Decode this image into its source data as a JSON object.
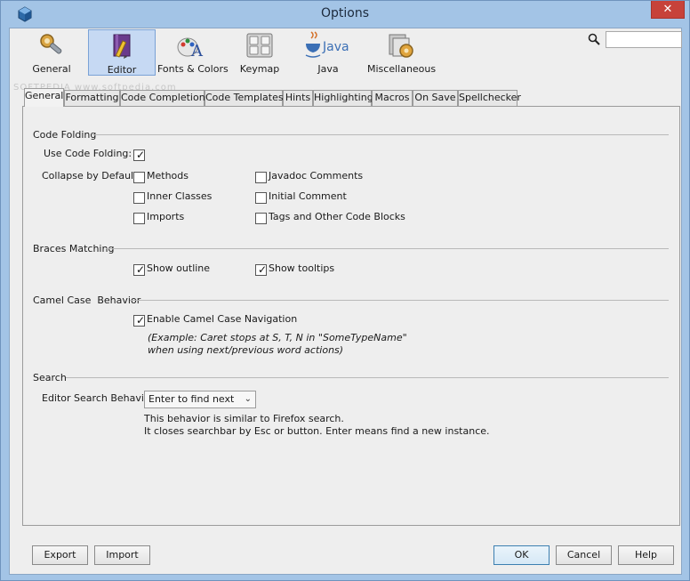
{
  "window": {
    "title": "Options",
    "close_label": "✕"
  },
  "categories": [
    {
      "label": "General",
      "icon": "gear-wrench-icon"
    },
    {
      "label": "Editor",
      "icon": "pencil-book-icon"
    },
    {
      "label": "Fonts & Colors",
      "icon": "font-palette-icon"
    },
    {
      "label": "Keymap",
      "icon": "keyboard-icon"
    },
    {
      "label": "Java",
      "icon": "java-icon"
    },
    {
      "label": "Miscellaneous",
      "icon": "misc-gear-icon"
    }
  ],
  "java_logo_text": "Java",
  "search": {
    "value": "",
    "placeholder": ""
  },
  "watermark": "SOFTPEDIA www.softpedia.com",
  "tabs": [
    "General",
    "Formatting",
    "Code Completion",
    "Code Templates",
    "Hints",
    "Highlighting",
    "Macros",
    "On Save",
    "Spellchecker"
  ],
  "code_folding": {
    "title": "Code Folding",
    "use_label": "Use Code Folding:",
    "use_checked": true,
    "collapse_label": "Collapse by Default:",
    "options": [
      {
        "label": "Methods",
        "checked": false
      },
      {
        "label": "Javadoc Comments",
        "checked": false
      },
      {
        "label": "Inner Classes",
        "checked": false
      },
      {
        "label": "Initial Comment",
        "checked": false
      },
      {
        "label": "Imports",
        "checked": false
      },
      {
        "label": "Tags and Other Code Blocks",
        "checked": false
      }
    ]
  },
  "braces": {
    "title": "Braces Matching",
    "show_outline": {
      "label": "Show outline",
      "checked": true
    },
    "show_tooltips": {
      "label": "Show tooltips",
      "checked": true
    }
  },
  "camel": {
    "title": "Camel Case  Behavior",
    "enable": {
      "label": "Enable Camel Case Navigation",
      "checked": true
    },
    "example_line1": "(Example: Caret stops at S, T, N in \"SomeTypeName\"",
    "example_line2": "when using next/previous word actions)"
  },
  "search_section": {
    "title": "Search",
    "behavior_label": "Editor Search Behavior",
    "behavior_value": "Enter to find next",
    "desc_line1": "This behavior is similar to Firefox search.",
    "desc_line2": "It closes searchbar by Esc or button. Enter means find a new instance."
  },
  "buttons": {
    "export": "Export",
    "import": "Import",
    "ok": "OK",
    "cancel": "Cancel",
    "help": "Help"
  }
}
